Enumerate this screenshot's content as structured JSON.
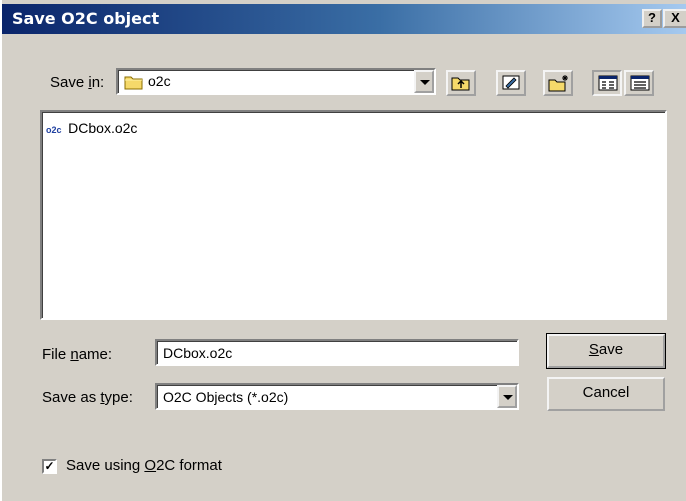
{
  "window": {
    "title": "Save O2C object",
    "help_label": "?",
    "close_label": "X"
  },
  "save_in": {
    "label_pre": "Save ",
    "label_access": "i",
    "label_post": "n:",
    "value": "o2c"
  },
  "file_list": [
    {
      "icon_text": "o2c",
      "name": "DCbox.o2c"
    }
  ],
  "file_name": {
    "label_pre": "File ",
    "label_access": "n",
    "label_post": "ame:",
    "value": "DCbox.o2c"
  },
  "save_as_type": {
    "label_pre": "Save as ",
    "label_access": "t",
    "label_post": "ype:",
    "value": "O2C Objects (*.o2c)"
  },
  "buttons": {
    "save_access": "S",
    "save_rest": "ave",
    "cancel": "Cancel"
  },
  "checkbox": {
    "mark": "✓",
    "label_pre": "Save using ",
    "label_access": "O",
    "label_post": "2C format",
    "checked": true
  },
  "icons": [
    "folder-icon",
    "up-one-level-icon",
    "desktop-icon",
    "new-folder-icon",
    "list-view-icon",
    "details-view-icon"
  ]
}
